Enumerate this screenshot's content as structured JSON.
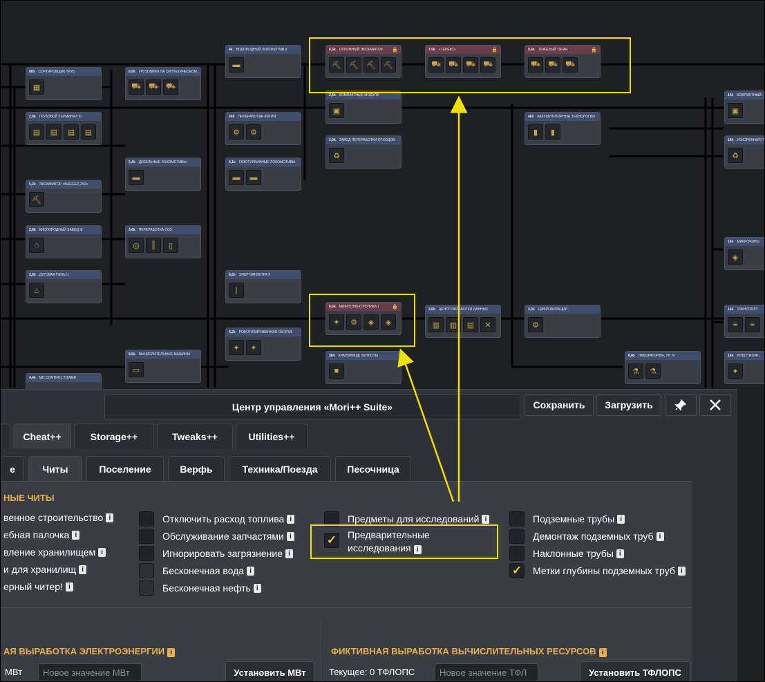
{
  "tech_tree": {
    "nodes": [
      {
        "id": "n1",
        "cost": "860",
        "title": "СОРТИРОВЩИК ТРУБ",
        "icons": [
          "ore"
        ],
        "locked": false
      },
      {
        "id": "n2",
        "cost": "8,9k",
        "title": "ГРУЗОВИКИ НА СИНТЕТИЧЕСКОМ...",
        "icons": [
          "truck",
          "truck",
          "truck"
        ],
        "locked": false
      },
      {
        "id": "n3",
        "cost": "4k",
        "title": "ВОДОРОДНЫЙ ЛОКОМОТИВ II",
        "icons": [
          "train"
        ],
        "locked": false
      },
      {
        "id": "n4",
        "cost": "6,5k",
        "title": "ОГРОМНЫЙ ЭКСКАВАТОР",
        "icons": [
          "excavator",
          "excavator",
          "excavator",
          "excavator"
        ],
        "locked": true
      },
      {
        "id": "n5",
        "cost": "7,5k",
        "title": "«ТЕРЕКС»",
        "icons": [
          "truck",
          "truck",
          "truck",
          "truck"
        ],
        "locked": true
      },
      {
        "id": "n6",
        "cost": "9,4k",
        "title": "ТЯЖЕЛЫЙ ТЯГАЧ",
        "icons": [
          "truck",
          "truck",
          "truck"
        ],
        "locked": true
      },
      {
        "id": "n7",
        "cost": "2,5k",
        "title": "КОМПАКТНЫЕ МОДУЛИ",
        "icons": [
          "module"
        ],
        "locked": false
      },
      {
        "id": "n8",
        "cost": "2,8k",
        "title": "ГРУЗОВОЙ ТЕРМИНАЛ III",
        "icons": [
          "crate",
          "crate",
          "crate",
          "crate"
        ],
        "locked": false
      },
      {
        "id": "n9",
        "cost": "240",
        "title": "ПЕРЕРАБОТКА ЛИТИЯ",
        "icons": [
          "machine",
          "machine"
        ],
        "locked": false
      },
      {
        "id": "n10",
        "cost": "2,9k",
        "title": "ЗАВОД ПЕРЕРАБОТКИ ОТХОДОВ",
        "icons": [
          "recycle"
        ],
        "locked": false
      },
      {
        "id": "n11",
        "cost": "460",
        "title": "АККУМУЛЯТОРНЫЕ ТЕХНОЛОГИИ",
        "icons": [
          "battery",
          "battery"
        ],
        "locked": false
      },
      {
        "id": "n12",
        "cost": "14k",
        "title": "КОМПАКТНЫЙ ...",
        "icons": [
          "module"
        ],
        "locked": false
      },
      {
        "id": "n13",
        "cost": "5,4k",
        "title": "ДИЗЕЛЬНЫЕ ЛОКОМОТИВЫ",
        "icons": [
          "train"
        ],
        "locked": false
      },
      {
        "id": "n14",
        "cost": "4,1k",
        "title": "ГАЗОТУРБИННЫЕ ЛОКОМОТИВЫ",
        "icons": [
          "train",
          "train"
        ],
        "locked": false
      },
      {
        "id": "n15",
        "cost": "14k",
        "title": "УСКОРЕННАЯ ПЕРЕРАБОТКА",
        "icons": [
          "recycle"
        ],
        "locked": false
      },
      {
        "id": "n16",
        "cost": "5,2k",
        "title": "ЭКСКАВАТОР «BAGGER 293»",
        "icons": [
          "excavator"
        ],
        "locked": false
      },
      {
        "id": "n17",
        "cost": "2,8k",
        "title": "КИСЛОРОДНЫЙ ЗАВОД III",
        "icons": [
          "factory"
        ],
        "locked": false
      },
      {
        "id": "n18",
        "cost": "3,6k",
        "title": "ПЕРЕРАБОТКА CO2",
        "icons": [
          "co2",
          "pipes",
          "tank"
        ],
        "locked": false
      },
      {
        "id": "n19",
        "cost": "14k",
        "title": "МИКРОЧИПЫ",
        "icons": [
          "chip"
        ],
        "locked": false
      },
      {
        "id": "n20",
        "cost": "3,9k",
        "title": "ДУГОВАЯ ПЕЧЬ II",
        "icons": [
          "furnace"
        ],
        "locked": false
      },
      {
        "id": "n21",
        "cost": "4,5k",
        "title": "ЭНЕРГИЯ ВЕТРА II",
        "icons": [
          "wind"
        ],
        "locked": false
      },
      {
        "id": "n22",
        "cost": "6,6k",
        "title": "МИКРОЭЛЕКТРОНИКА I",
        "icons": [
          "robot",
          "machine",
          "chip",
          "chip"
        ],
        "locked": true
      },
      {
        "id": "n23",
        "cost": "3,6k",
        "title": "ЦЕНТР ОБРАБОТКИ ДАННЫХ",
        "icons": [
          "server",
          "server",
          "crate",
          "tools"
        ],
        "locked": false
      },
      {
        "id": "n24",
        "cost": "3,9k",
        "title": "ЦИФРОВИЗАЦИЯ",
        "icons": [
          "machine"
        ],
        "locked": false
      },
      {
        "id": "n25",
        "cost": "14k",
        "title": "ТРАНСПОРТ",
        "icons": [
          "belt",
          "belt"
        ],
        "locked": false
      },
      {
        "id": "n26",
        "cost": "4,2k",
        "title": "РОБОТИЗИРОВАННАЯ СБОРКА",
        "icons": [
          "robot",
          "robot"
        ],
        "locked": false
      },
      {
        "id": "n27",
        "cost": "384",
        "title": "ХРАНИЛИЩЕ ТЕПЛОТЫ",
        "icons": [
          "block"
        ],
        "locked": false
      },
      {
        "id": "n28",
        "cost": "8,6k",
        "title": "ВЫЧИСЛИТЕЛЬНЫЕ МАШИНЫ",
        "icons": [
          "computer"
        ],
        "locked": false
      },
      {
        "id": "n29",
        "cost": "8,8k",
        "title": "ЛАБОРАТОРИЯ, УР. IV",
        "icons": [
          "lab",
          "lab"
        ],
        "locked": false
      },
      {
        "id": "n30",
        "cost": "14k",
        "title": "РОБОТИЗИР...",
        "icons": [
          "robot"
        ],
        "locked": false
      },
      {
        "id": "n31",
        "cost": "4,4k",
        "title": "MD CONTROL TOWER",
        "icons": [],
        "locked": false
      }
    ]
  },
  "panel": {
    "title": "Центр управления «Mori++ Suite»",
    "save_label": "Сохранить",
    "load_label": "Загрузить",
    "pin_icon": "pin-icon",
    "close_icon": "close-icon",
    "tabs": [
      "Cheat++",
      "Storage++",
      "Tweaks++",
      "Utilities++"
    ],
    "subtabs": [
      "е",
      "Читы",
      "Поселение",
      "Верфь",
      "Техника/Поезда",
      "Песочница"
    ],
    "section1_title": "НЫЕ ЧИТЫ",
    "col1": [
      "венное строительство",
      "ебная палочка",
      "вление хранилищем",
      "и для хранилищ",
      "ерный читер!"
    ],
    "col2": [
      {
        "label": "Отключить расход топлива",
        "checked": false,
        "dim": false
      },
      {
        "label": "Обслуживание запчастями",
        "checked": false,
        "dim": false
      },
      {
        "label": "Игнорировать загрязнение",
        "checked": false,
        "dim": false
      },
      {
        "label": "Бесконечная вода",
        "checked": false,
        "dim": true
      },
      {
        "label": "Бесконечная нефть",
        "checked": false,
        "dim": true
      }
    ],
    "col3": [
      {
        "label": "Предметы для исследований",
        "checked": false
      },
      {
        "label_line1": "Предварительные",
        "label_line2": "исследования",
        "checked": true
      }
    ],
    "col4": [
      {
        "label": "Подземные трубы",
        "checked": false
      },
      {
        "label": "Демонтаж подземных труб",
        "checked": false
      },
      {
        "label": "Наклонные трубы",
        "checked": false
      },
      {
        "label": "Метки глубины подземных труб",
        "checked": true
      }
    ],
    "power": {
      "title": "АЯ ВЫРАБОТКА ЭЛЕКТРОЭНЕРГИИ",
      "current_suffix": "МВт",
      "placeholder": "Новое значение МВт",
      "button": "Установить МВт"
    },
    "compute": {
      "title": "ФИКТИВНАЯ ВЫРАБОТКА ВЫЧИСЛИТЕЛЬНЫХ РЕСУРСОВ",
      "current": "Текущее: 0 ТФЛОПС",
      "placeholder": "Новое значение ТФЛ",
      "button": "Установить ТФЛОПС"
    }
  },
  "colors": {
    "highlight": "#f0e000",
    "accent": "#e8b04a",
    "check": "#f2c744"
  }
}
